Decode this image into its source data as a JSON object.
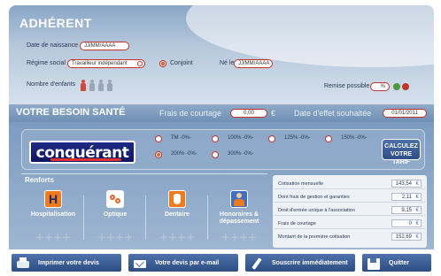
{
  "adherent": {
    "title": "ADHÉRENT",
    "birth_label": "Date de naissance",
    "birth_value": "JJ/MM/AAAA",
    "regime_label": "Régime social",
    "regime_value": "Travailleur indépendant",
    "conjoint_label": "Conjoint",
    "ne_le_label": "Né le",
    "ne_le_value": "JJ/MM/AAAA",
    "children_label": "Nombre d'enfants",
    "remise_label": "Remise possible",
    "remise_value": "%"
  },
  "besoin": {
    "title": "VOTRE BESOIN SANTÉ",
    "frais_label": "Frais de courtage",
    "frais_value": "0,00",
    "frais_unit": "€",
    "date_label": "Date d'effet souhaitée",
    "date_value": "01/01/2011"
  },
  "offer": {
    "logo_text": "conquérant",
    "options": [
      "TM -0%-",
      "100% -0%-",
      "125% -0%-",
      "150% -0%-",
      "200% -0%-",
      "300% -0%-"
    ],
    "selected_option": "200% -0%-",
    "calc_label_1": "CALCULEZ",
    "calc_label_2": "VOTRE TARIF"
  },
  "renforts": {
    "title": "Renforts",
    "items": [
      {
        "label": "Hospitalisation",
        "icon": "hospital-icon"
      },
      {
        "label": "Optique",
        "icon": "glasses-icon"
      },
      {
        "label": "Dentaire",
        "icon": "tooth-icon"
      },
      {
        "label": "Honoraires & dépassement",
        "icon": "doctor-icon"
      }
    ],
    "plus_marks": "++++"
  },
  "cotisation": {
    "rows": [
      {
        "label": "Cotisation mensuelle",
        "value": "143,54"
      },
      {
        "label": "Dont frais de gestion et garanties",
        "value": "2,11"
      },
      {
        "label": "Droit d'entrée unique à l'association",
        "value": "9,15"
      },
      {
        "label": "Frais de courtage",
        "value": "0"
      },
      {
        "label": "Montant de la première cotisation",
        "value": "152,69"
      }
    ]
  },
  "buttons": {
    "print": "Imprimer votre devis",
    "email": "Votre devis par e-mail",
    "subscribe": "Souscrire immédiatement",
    "quit": "Quitter"
  },
  "colors": {
    "accent_red": "#c2342b",
    "panel_blue": "#7d9cc1",
    "logo_navy": "#1d2a86"
  }
}
